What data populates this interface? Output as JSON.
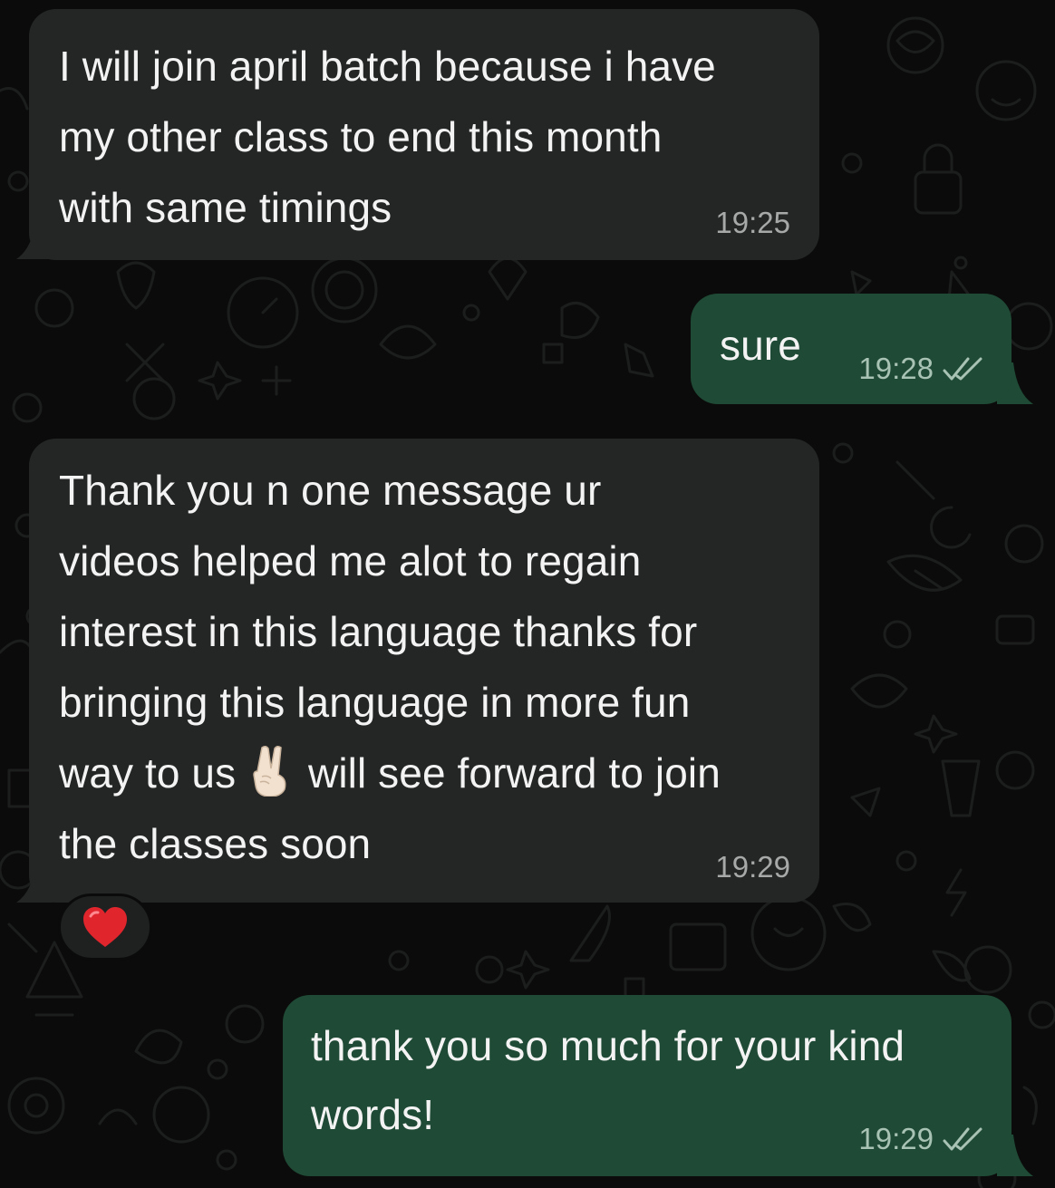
{
  "chat": {
    "messages": [
      {
        "direction": "incoming",
        "lines": [
          "I will join april batch because i have",
          "my other class to end this month",
          "with same timings"
        ],
        "time": "19:25"
      },
      {
        "direction": "outgoing",
        "lines": [
          "sure"
        ],
        "time": "19:28",
        "status_icon": "double-check-icon"
      },
      {
        "direction": "incoming",
        "lines": [
          "Thank you n one message ur",
          "videos helped me alot to regain",
          "interest in this language thanks for",
          "bringing this language in more fun",
          "way to us",
          "will see forward to join",
          "the classes soon"
        ],
        "inline_emoji": "victory-hand-emoji",
        "time": "19:29",
        "reaction": "red-heart-emoji"
      },
      {
        "direction": "outgoing",
        "lines": [
          "thank you so much for your kind",
          "words!"
        ],
        "time": "19:29",
        "status_icon": "double-check-icon"
      }
    ]
  },
  "colors": {
    "background": "#0b0b0b",
    "incoming_bubble": "#242626",
    "outgoing_bubble": "#1f4a35",
    "timestamp": "#a6a9a8"
  }
}
